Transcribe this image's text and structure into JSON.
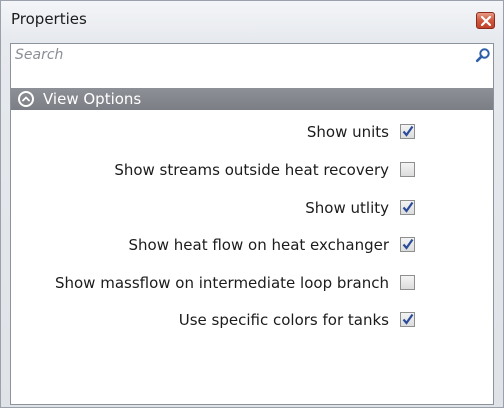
{
  "window": {
    "title": "Properties"
  },
  "search": {
    "placeholder": "Search",
    "value": ""
  },
  "section": {
    "label": "View Options",
    "expanded": true
  },
  "options": [
    {
      "label": "Show units",
      "checked": true
    },
    {
      "label": "Show streams outside heat recovery",
      "checked": false
    },
    {
      "label": "Show utlity",
      "checked": true
    },
    {
      "label": "Show heat flow on heat exchanger",
      "checked": true
    },
    {
      "label": "Show massflow on intermediate loop branch",
      "checked": false
    },
    {
      "label": "Use specific colors for tanks",
      "checked": true
    }
  ],
  "colors": {
    "section_header": "#7f8288",
    "close_button": "#d0573e",
    "check_mark": "#2a4c9a"
  }
}
